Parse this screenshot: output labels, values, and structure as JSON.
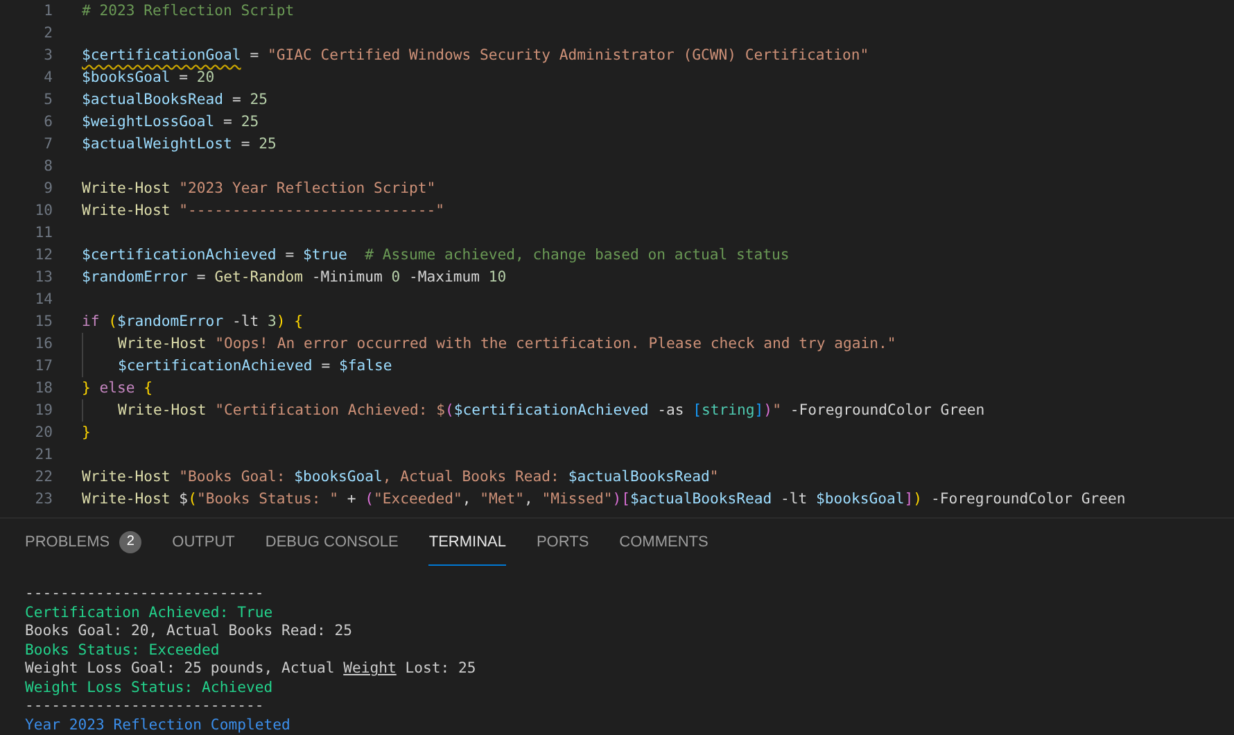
{
  "editor": {
    "lines": [
      {
        "number": "1",
        "tokens": [
          {
            "kind": "comment",
            "text": "# 2023 Reflection Script"
          }
        ]
      },
      {
        "number": "2"
      },
      {
        "number": "3",
        "tokens": [
          {
            "kind": "var",
            "text": "$certificationGoal",
            "warning": true
          },
          {
            "kind": "op",
            "text": " = "
          },
          {
            "kind": "string",
            "text": "\"GIAC Certified Windows Security Administrator (GCWN) Certification\""
          }
        ]
      },
      {
        "number": "4",
        "tokens": [
          {
            "kind": "var",
            "text": "$booksGoal"
          },
          {
            "kind": "op",
            "text": " = "
          },
          {
            "kind": "num",
            "text": "20"
          }
        ]
      },
      {
        "number": "5",
        "tokens": [
          {
            "kind": "var",
            "text": "$actualBooksRead"
          },
          {
            "kind": "op",
            "text": " = "
          },
          {
            "kind": "num",
            "text": "25"
          }
        ]
      },
      {
        "number": "6",
        "tokens": [
          {
            "kind": "var",
            "text": "$weightLossGoal"
          },
          {
            "kind": "op",
            "text": " = "
          },
          {
            "kind": "num",
            "text": "25"
          }
        ]
      },
      {
        "number": "7",
        "tokens": [
          {
            "kind": "var",
            "text": "$actualWeightLost"
          },
          {
            "kind": "op",
            "text": " = "
          },
          {
            "kind": "num",
            "text": "25"
          }
        ]
      },
      {
        "number": "8"
      },
      {
        "number": "9",
        "tokens": [
          {
            "kind": "cmd",
            "text": "Write-Host "
          },
          {
            "kind": "string",
            "text": "\"2023 Year Reflection Script\""
          }
        ]
      },
      {
        "number": "10",
        "tokens": [
          {
            "kind": "cmd",
            "text": "Write-Host "
          },
          {
            "kind": "string",
            "text": "\"----------------------------\""
          }
        ]
      },
      {
        "number": "11"
      },
      {
        "number": "12",
        "tokens": [
          {
            "kind": "var",
            "text": "$certificationAchieved"
          },
          {
            "kind": "op",
            "text": " = "
          },
          {
            "kind": "var",
            "text": "$true  "
          },
          {
            "kind": "comment",
            "text": "# Assume achieved, change based on actual status"
          }
        ]
      },
      {
        "number": "13",
        "tokens": [
          {
            "kind": "var",
            "text": "$randomError"
          },
          {
            "kind": "op",
            "text": " = "
          },
          {
            "kind": "cmd",
            "text": "Get-Random"
          },
          {
            "kind": "op",
            "text": " -Minimum "
          },
          {
            "kind": "num",
            "text": "0"
          },
          {
            "kind": "op",
            "text": " -Maximum "
          },
          {
            "kind": "num",
            "text": "10"
          }
        ]
      },
      {
        "number": "14"
      },
      {
        "number": "15",
        "tokens": [
          {
            "kind": "keyword",
            "text": "if "
          },
          {
            "kind": "bracket1",
            "text": "("
          },
          {
            "kind": "var",
            "text": "$randomError"
          },
          {
            "kind": "op",
            "text": " -lt "
          },
          {
            "kind": "num",
            "text": "3"
          },
          {
            "kind": "bracket1",
            "text": ") {"
          }
        ]
      },
      {
        "number": "16",
        "indent": true,
        "tokens": [
          {
            "kind": "cmd",
            "text": "Write-Host "
          },
          {
            "kind": "string",
            "text": "\"Oops! An error occurred with the certification. Please check and try again.\""
          }
        ]
      },
      {
        "number": "17",
        "indent": true,
        "tokens": [
          {
            "kind": "var",
            "text": "$certificationAchieved"
          },
          {
            "kind": "op",
            "text": " = "
          },
          {
            "kind": "var",
            "text": "$false"
          }
        ]
      },
      {
        "number": "18",
        "tokens": [
          {
            "kind": "bracket1",
            "text": "} "
          },
          {
            "kind": "keyword",
            "text": "else "
          },
          {
            "kind": "bracket1",
            "text": "{"
          }
        ]
      },
      {
        "number": "19",
        "indent": true,
        "tokens": [
          {
            "kind": "cmd",
            "text": "Write-Host "
          },
          {
            "kind": "string",
            "text": "\"Certification Achieved: $"
          },
          {
            "kind": "bracket2",
            "text": "("
          },
          {
            "kind": "var",
            "text": "$certificationAchieved"
          },
          {
            "kind": "op",
            "text": " -as "
          },
          {
            "kind": "bracket3",
            "text": "["
          },
          {
            "kind": "type",
            "text": "string"
          },
          {
            "kind": "bracket3",
            "text": "]"
          },
          {
            "kind": "bracket2",
            "text": ")"
          },
          {
            "kind": "string",
            "text": "\""
          },
          {
            "kind": "op",
            "text": " -ForegroundColor Green"
          }
        ]
      },
      {
        "number": "20",
        "tokens": [
          {
            "kind": "bracket1",
            "text": "}"
          }
        ]
      },
      {
        "number": "21"
      },
      {
        "number": "22",
        "tokens": [
          {
            "kind": "cmd",
            "text": "Write-Host "
          },
          {
            "kind": "string",
            "text": "\"Books Goal: "
          },
          {
            "kind": "var",
            "text": "$booksGoal"
          },
          {
            "kind": "string",
            "text": ", Actual Books Read: "
          },
          {
            "kind": "var",
            "text": "$actualBooksRead"
          },
          {
            "kind": "string",
            "text": "\""
          }
        ]
      },
      {
        "number": "23",
        "tokens": [
          {
            "kind": "cmd",
            "text": "Write-Host "
          },
          {
            "kind": "op",
            "text": "$"
          },
          {
            "kind": "bracket1",
            "text": "("
          },
          {
            "kind": "string",
            "text": "\"Books Status: \""
          },
          {
            "kind": "op",
            "text": " + "
          },
          {
            "kind": "bracket2",
            "text": "("
          },
          {
            "kind": "string",
            "text": "\"Exceeded\""
          },
          {
            "kind": "op",
            "text": ", "
          },
          {
            "kind": "string",
            "text": "\"Met\""
          },
          {
            "kind": "op",
            "text": ", "
          },
          {
            "kind": "string",
            "text": "\"Missed\""
          },
          {
            "kind": "bracket2",
            "text": ")["
          },
          {
            "kind": "var",
            "text": "$actualBooksRead"
          },
          {
            "kind": "op",
            "text": " -lt "
          },
          {
            "kind": "var",
            "text": "$booksGoal"
          },
          {
            "kind": "bracket2",
            "text": "]"
          },
          {
            "kind": "bracket1",
            "text": ")"
          },
          {
            "kind": "op",
            "text": " -ForegroundColor Green"
          }
        ]
      }
    ]
  },
  "panel": {
    "tabs": [
      {
        "label": "PROBLEMS",
        "badge": "2",
        "selected": false
      },
      {
        "label": "OUTPUT",
        "selected": false
      },
      {
        "label": "DEBUG CONSOLE",
        "selected": false
      },
      {
        "label": "TERMINAL",
        "selected": true
      },
      {
        "label": "PORTS",
        "selected": false
      },
      {
        "label": "COMMENTS",
        "selected": false
      }
    ],
    "terminal": [
      {
        "kind": "plain",
        "segments": [
          {
            "text": "---------------------------"
          }
        ]
      },
      {
        "kind": "green",
        "segments": [
          {
            "text": "Certification Achieved: True"
          }
        ]
      },
      {
        "kind": "plain",
        "segments": [
          {
            "text": "Books Goal: 20, Actual Books Read: 25"
          }
        ]
      },
      {
        "kind": "green",
        "segments": [
          {
            "text": "Books Status: Exceeded"
          }
        ]
      },
      {
        "kind": "plain",
        "segments": [
          {
            "text": "Weight Loss Goal: 25 pounds, Actual "
          },
          {
            "text": "Weight",
            "underlined": true
          },
          {
            "text": " Lost: 25"
          }
        ]
      },
      {
        "kind": "green",
        "segments": [
          {
            "text": "Weight Loss Status: Achieved"
          }
        ]
      },
      {
        "kind": "plain",
        "segments": [
          {
            "text": "---------------------------"
          }
        ]
      },
      {
        "kind": "blue",
        "segments": [
          {
            "text": "Year 2023 Reflection Completed"
          }
        ]
      }
    ]
  }
}
